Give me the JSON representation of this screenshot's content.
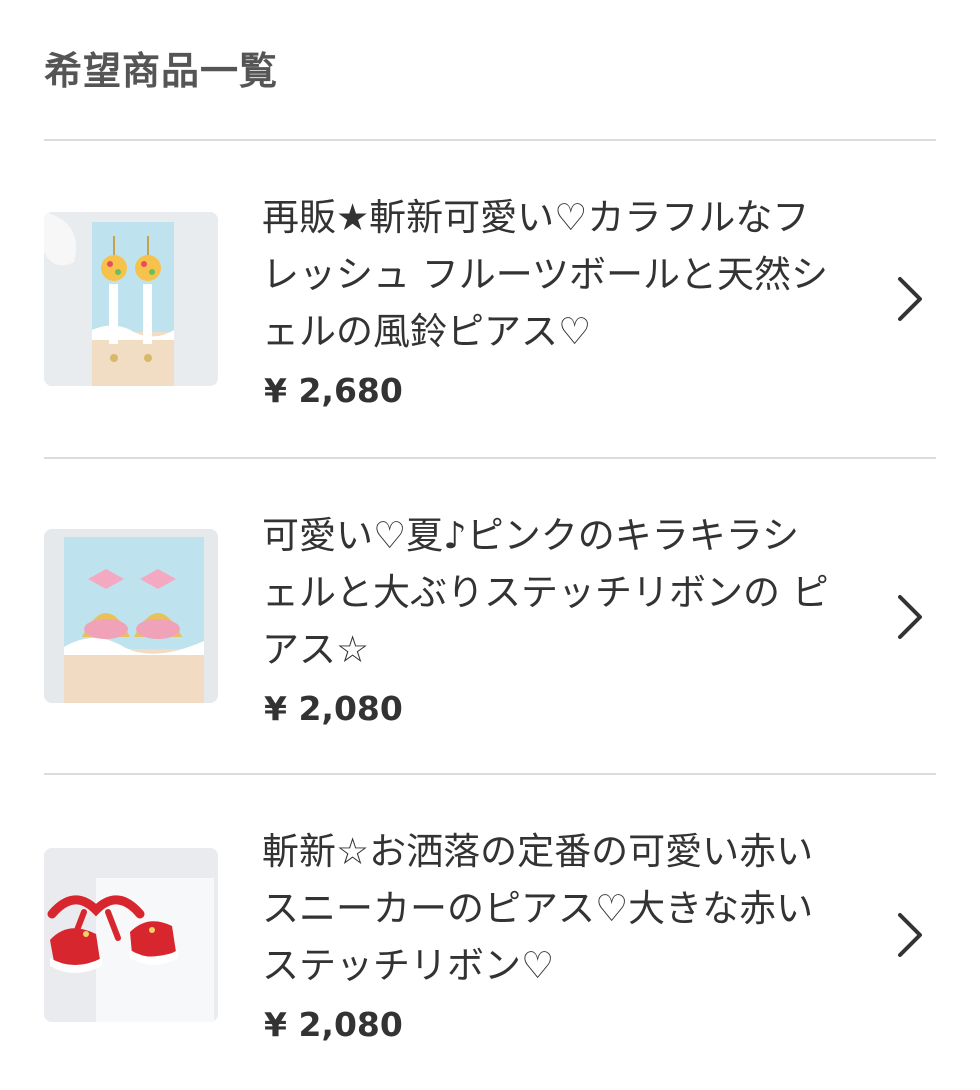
{
  "page": {
    "title": "希望商品一覧"
  },
  "items": [
    {
      "title": "再販★斬新可愛い♡カラフルなフレッシュ フルーツボールと天然シェルの風鈴ピアス♡",
      "price": "¥ 2,680",
      "thumbnail_icon": "earring-fruit-ball-shell-icon"
    },
    {
      "title": "可愛い♡夏♪ピンクのキラキラシェルと大ぶりステッチリボンの ピアス☆",
      "price": "¥ 2,080",
      "thumbnail_icon": "earring-pink-shell-ribbon-icon"
    },
    {
      "title": "斬新☆お洒落の定番の可愛い赤いスニーカーのピアス♡大きな赤いステッチリボン♡",
      "price": "¥ 2,080",
      "thumbnail_icon": "earring-red-sneaker-icon"
    }
  ],
  "colors": {
    "divider": "#dcdcdc",
    "title_text": "#555555",
    "body_text": "#333333"
  }
}
